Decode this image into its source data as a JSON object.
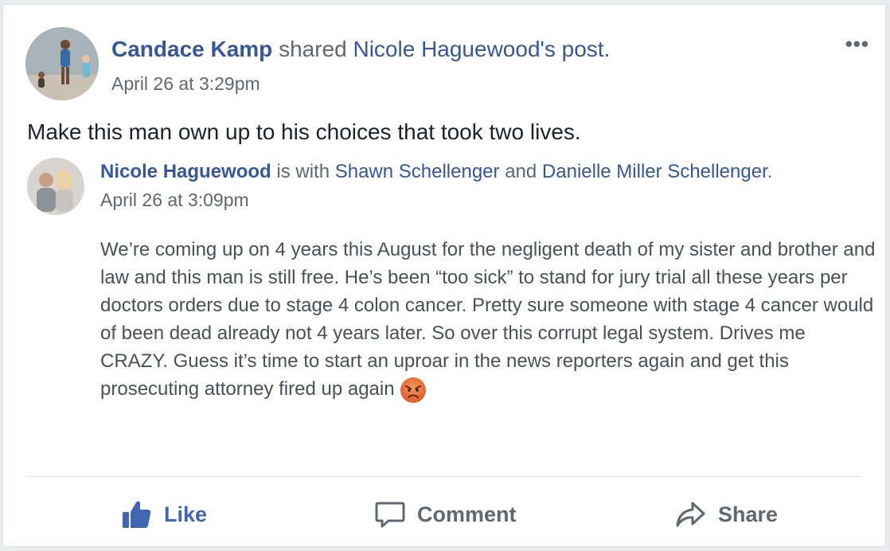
{
  "post": {
    "author": "Candace Kamp",
    "shared_verb": "shared",
    "shared_owner": "Nicole Haguewood's",
    "shared_object": "post.",
    "timestamp": "April 26 at 3:29pm",
    "text": "Make this man own up to his choices that took two lives.",
    "more_label": "•••"
  },
  "shared_post": {
    "author": "Nicole Haguewood",
    "with_text": "is with",
    "tagged_1": "Shawn Schellenger",
    "and_text": "and",
    "tagged_2": "Danielle Miller Schellenger",
    "period": ".",
    "timestamp": "April 26 at 3:09pm",
    "body": "We’re coming up on 4 years this August for the negligent death of my sister and brother and law and this man is still free. He’s been “too sick” to stand for jury trial all these years per doctors orders due to stage 4 colon cancer. Pretty sure someone with stage 4 cancer would of been dead already not 4 years later. So over this corrupt legal system. Drives me CRAZY. Guess it’s time to start an uproar in the news reporters again and get this prosecuting attorney fired up again",
    "emoji": "angry-face-emoji"
  },
  "actions": {
    "like": "Like",
    "comment": "Comment",
    "share": "Share"
  },
  "colors": {
    "link": "#365899",
    "like_blue": "#4267b2",
    "muted": "#616770"
  }
}
